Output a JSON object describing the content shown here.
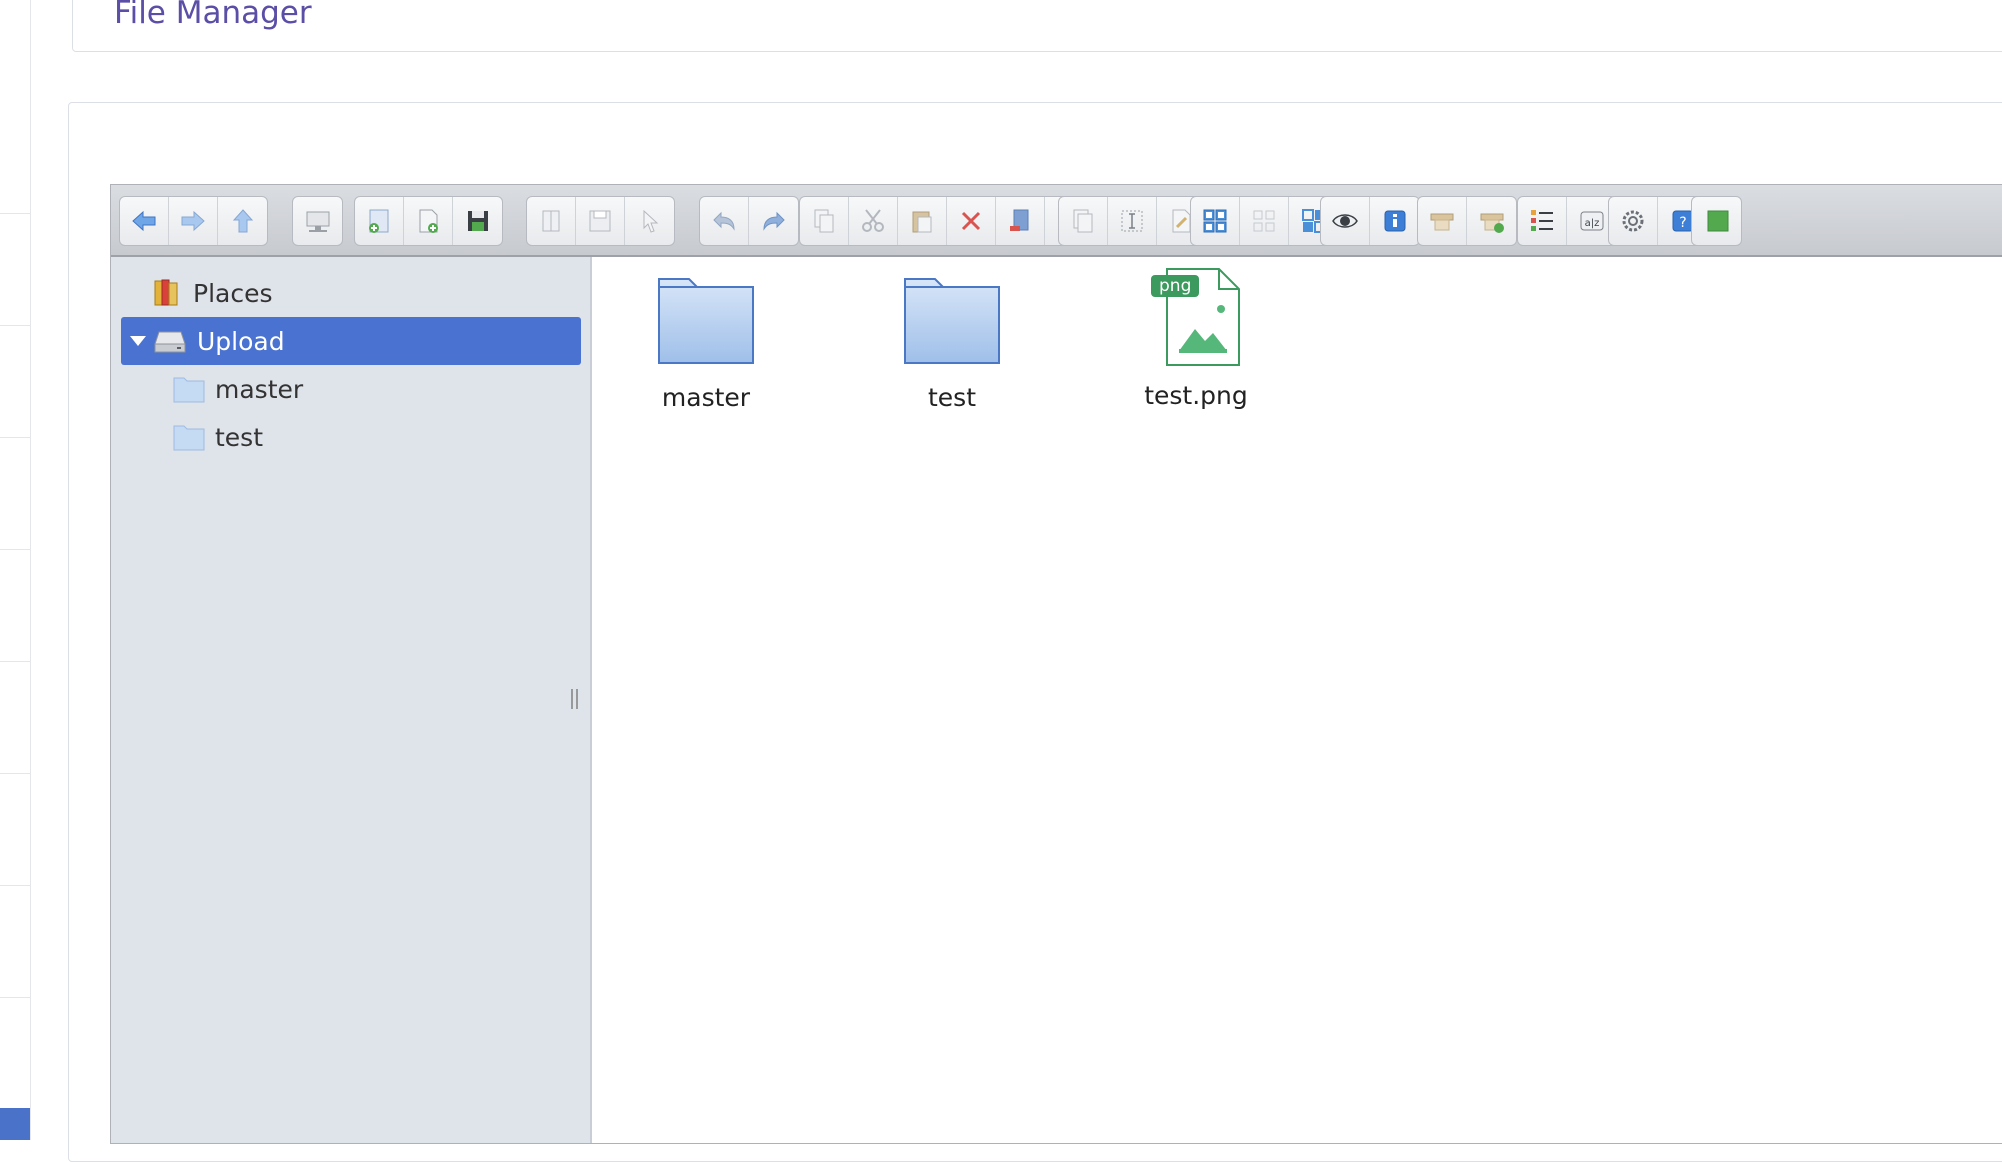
{
  "page": {
    "title": "File Manager"
  },
  "navbar": {
    "places_label": "Places",
    "root_label": "Upload",
    "children": [
      "master",
      "test"
    ]
  },
  "files": [
    {
      "name": "master",
      "type": "folder"
    },
    {
      "name": "test",
      "type": "folder"
    },
    {
      "name": "test.png",
      "type": "image",
      "badge": "png"
    }
  ],
  "toolbar_groups": [
    [
      "back-icon",
      "forward-icon",
      "up-icon"
    ],
    [
      "home-icon"
    ],
    [
      "upload-icon",
      "new-file-icon",
      "save-icon"
    ],
    [
      "open-icon",
      "download-icon",
      "select-icon"
    ],
    [
      "undo-icon",
      "redo-icon"
    ],
    [
      "copy-icon",
      "cut-icon",
      "paste-icon",
      "delete-icon",
      "empty-icon",
      "resize-icon"
    ],
    [
      "duplicate-icon",
      "rename-icon",
      "edit-icon",
      "archive-icon"
    ],
    [
      "select-all-icon",
      "select-none-icon",
      "select-invert-icon"
    ],
    [
      "preview-icon",
      "info-icon"
    ],
    [
      "extract-icon",
      "compress-icon"
    ],
    [
      "view-list-icon",
      "sort-icon"
    ],
    [
      "settings-icon",
      "help-icon"
    ],
    [
      "fullscreen-icon"
    ]
  ],
  "colors": {
    "accent": "#4a72d1",
    "title": "#5a4ea6",
    "folder_fill": "#b9d1f0",
    "folder_stroke": "#4a78c4",
    "image_green": "#3d9a5e"
  }
}
